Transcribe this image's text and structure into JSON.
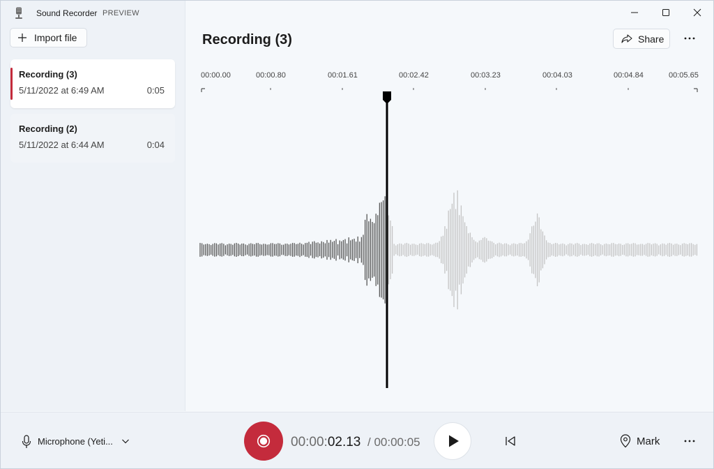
{
  "window": {
    "app_title": "Sound Recorder",
    "preview_badge": "PREVIEW"
  },
  "sidebar": {
    "import_label": "Import file",
    "recordings": [
      {
        "name": "Recording (3)",
        "date": "5/11/2022 at 6:49 AM",
        "duration": "0:05",
        "selected": true
      },
      {
        "name": "Recording (2)",
        "date": "5/11/2022 at 6:44 AM",
        "duration": "0:04",
        "selected": false
      }
    ]
  },
  "main": {
    "title": "Recording (3)",
    "share_label": "Share",
    "timeline_ticks": [
      "00:00.00",
      "00:00.80",
      "00:01.61",
      "00:02.42",
      "00:03.23",
      "00:04.03",
      "00:04.84",
      "00:05.65"
    ]
  },
  "playback": {
    "current_time_prefix": "00:00:",
    "current_time_value": "02.13",
    "total_time": "/ 00:00:05",
    "position_fraction": 0.377
  },
  "bottom": {
    "microphone_label": "Microphone (Yeti...",
    "mark_label": "Mark"
  },
  "colors": {
    "accent_red": "#c42b3c",
    "waveform_played": "#555555",
    "waveform_unplayed": "#c4c4c4",
    "playhead": "#000000"
  },
  "icons": {
    "app": "microphone-icon",
    "import": "plus-icon",
    "share": "share-icon",
    "more": "more-horizontal-icon",
    "mic": "microphone-icon",
    "chevron": "chevron-down-icon",
    "record": "record-icon",
    "play": "play-icon",
    "previous": "skip-back-icon",
    "mark": "map-pin-icon"
  }
}
